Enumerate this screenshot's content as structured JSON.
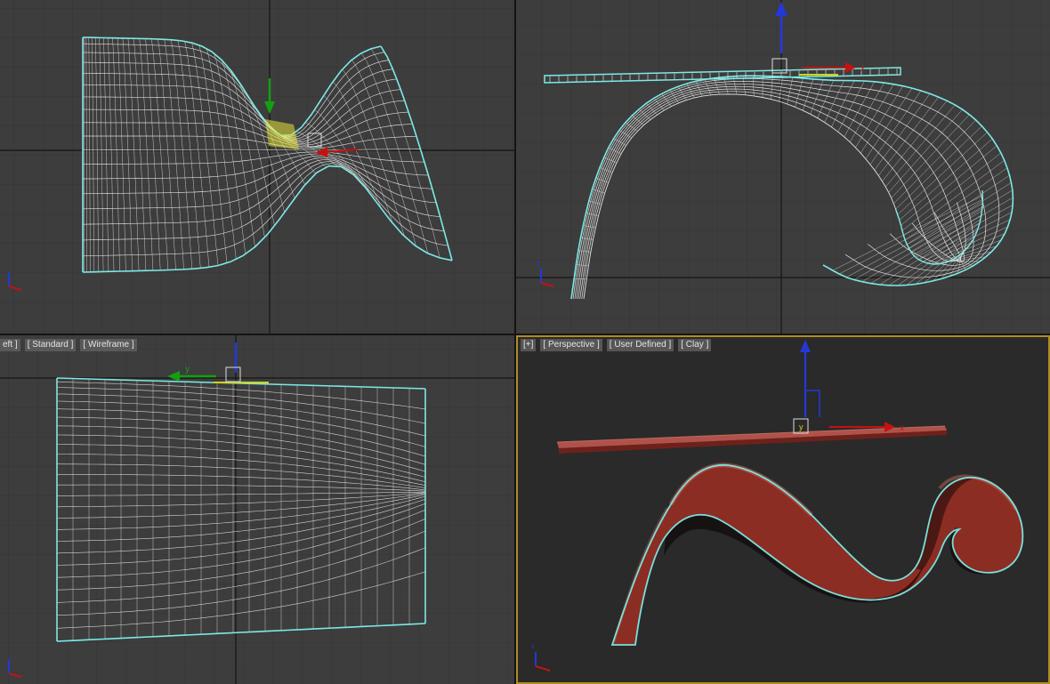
{
  "viewport_labels": {
    "bottom_left": {
      "segments": [
        "eft ]",
        "[ Standard ]",
        "[ Wireframe ]"
      ]
    },
    "bottom_right": {
      "segments": [
        "[+]",
        "[ Perspective ]",
        "[ User Defined ]",
        "[ Clay ]"
      ]
    }
  },
  "axis_labels": {
    "x": "x",
    "y": "y",
    "z": "z"
  },
  "colors": {
    "viewport_bg": "#3d3d3d",
    "persp_bg": "#2a2a2a",
    "grid_minor": "#353535",
    "grid_axis": "#1b1b1b",
    "wireframe": "#ededed",
    "selection_cyan": "#7ceae6",
    "active_border": "#b08c25",
    "gizmo_x_red": "#c41212",
    "gizmo_y_green": "#12a012",
    "gizmo_z_blue": "#2438d8",
    "gizmo_highlight_yellow": "#d2d21e",
    "selected_face_yellow": "#e6e63c",
    "selection_bracket_white": "#dddddd",
    "clay_base": "#8c2d24",
    "clay_highlight": "#cf6a58",
    "clay_shadow": "#0c0403",
    "slab_top": "#b0524a",
    "slab_front": "#6e211b"
  }
}
